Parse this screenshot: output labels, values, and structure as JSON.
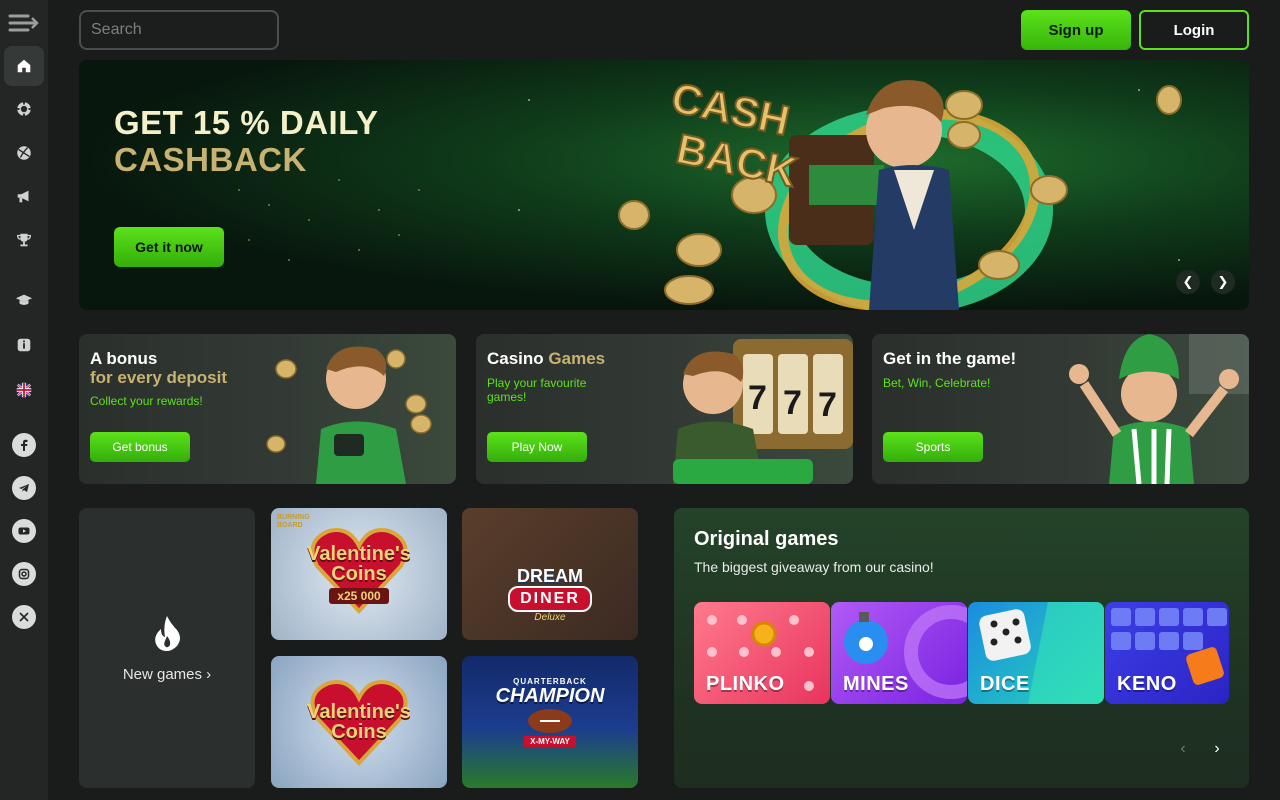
{
  "sidebar": {
    "menu_icon": "menu-collapse-icon",
    "items": [
      {
        "icon": "home-icon"
      },
      {
        "icon": "casino-chip-icon"
      },
      {
        "icon": "sports-ball-icon"
      },
      {
        "icon": "megaphone-icon"
      },
      {
        "icon": "trophy-icon"
      },
      {
        "icon": "graduation-cap-icon"
      },
      {
        "icon": "info-icon"
      },
      {
        "icon": "uk-flag-icon"
      }
    ],
    "socials": [
      "facebook-icon",
      "telegram-icon",
      "youtube-icon",
      "instagram-icon",
      "x-icon"
    ]
  },
  "header": {
    "search_placeholder": "Search",
    "signup_label": "Sign up",
    "login_label": "Login"
  },
  "hero": {
    "title_line1": "GET 15 % DAILY",
    "title_line2": "CASHBACK",
    "button_label": "Get it now",
    "art_text_1": "CASH",
    "art_text_2": "BACK"
  },
  "promos": [
    {
      "title": "A bonus",
      "title_accent": "for every deposit",
      "subtitle": "Collect your rewards!",
      "button": "Get bonus"
    },
    {
      "title": "Casino",
      "title_accent": "Games",
      "subtitle": "Play your favourite games!",
      "button": "Play Now"
    },
    {
      "title": "Get in the game!",
      "title_accent": "",
      "subtitle": "Bet, Win, Celebrate!",
      "button": "Sports"
    }
  ],
  "new_games": {
    "label": "New games",
    "tiles": [
      {
        "line1": "Valentine's",
        "line2": "Coins",
        "badge": "x25 000",
        "corner": "BURNING BOARD"
      },
      {
        "line1": "DREAM",
        "line2": "DINER",
        "sub": "Deluxe"
      },
      {
        "line1": "Valentine's",
        "line2": "Coins"
      },
      {
        "line1": "QUARTERBACK",
        "line2": "CHAMPION",
        "sub": "X-MY-WAY"
      }
    ]
  },
  "originals": {
    "title": "Original games",
    "subtitle": "The biggest giveaway from our casino!",
    "games": [
      {
        "label": "PLINKO",
        "color": "#f25a7a"
      },
      {
        "label": "MINES",
        "color": "#9b3cf2"
      },
      {
        "label": "DICE",
        "color": "#2ad3c1"
      },
      {
        "label": "KENO",
        "color": "#3b3fe0"
      }
    ]
  },
  "colors": {
    "accent": "#5ce21a",
    "gold": "#c9b271",
    "background": "#1a1c1b"
  }
}
